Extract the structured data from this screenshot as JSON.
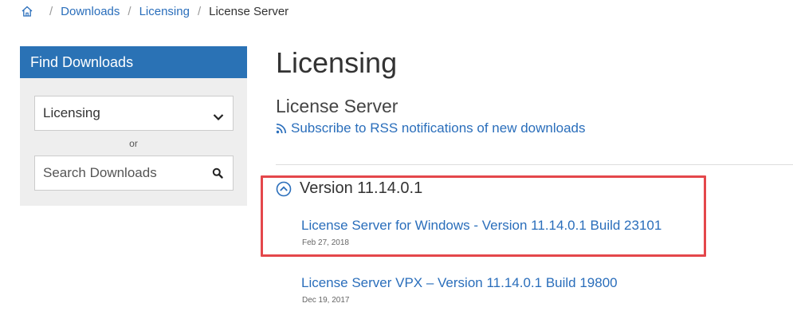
{
  "breadcrumb": {
    "items": [
      "Downloads",
      "Licensing"
    ],
    "current": "License Server",
    "separator": "/"
  },
  "sidebar": {
    "title": "Find Downloads",
    "product_select": {
      "value": "Licensing"
    },
    "or_label": "or",
    "search": {
      "placeholder": "Search Downloads"
    }
  },
  "main": {
    "title": "Licensing",
    "subtitle": "License Server",
    "rss_link": "Subscribe to RSS notifications of new downloads",
    "version_heading": "Version 11.14.0.1",
    "downloads": [
      {
        "title": "License Server for Windows - Version 11.14.0.1 Build 23101",
        "date": "Feb 27, 2018"
      },
      {
        "title": "License Server VPX – Version 11.14.0.1 Build 19800",
        "date": "Dec 19, 2017"
      }
    ]
  },
  "colors": {
    "link": "#2a6ebb",
    "header_bg": "#2a72b5",
    "highlight": "#e4474b",
    "sidebar_bg": "#eeeeee"
  }
}
